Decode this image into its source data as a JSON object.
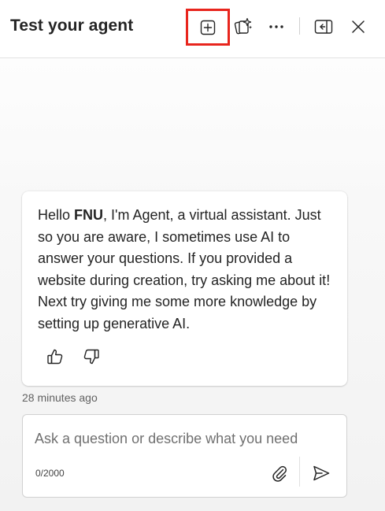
{
  "header": {
    "title": "Test your agent"
  },
  "message": {
    "greeting": "Hello ",
    "user_name": "FNU",
    "body": ", I'm Agent, a virtual assistant. Just so you are aware, I sometimes use AI to answer your questions. If you provided a website during creation, try asking me about it! Next try giving me some more knowledge by setting up generative AI.",
    "timestamp": "28 minutes ago"
  },
  "composer": {
    "placeholder": "Ask a question or describe what you need",
    "value": "",
    "char_count": "0/2000"
  },
  "icons": {
    "new_chat": "plus-square-icon",
    "copilot": "copilot-sparkle-icon",
    "more": "more-horizontal-icon",
    "panel": "panel-collapse-icon",
    "close": "close-icon",
    "like": "thumbs-up-icon",
    "dislike": "thumbs-down-icon",
    "attach": "paperclip-icon",
    "send": "send-icon"
  },
  "colors": {
    "highlight": "#e8251d",
    "text": "#242424",
    "muted": "#616161"
  }
}
